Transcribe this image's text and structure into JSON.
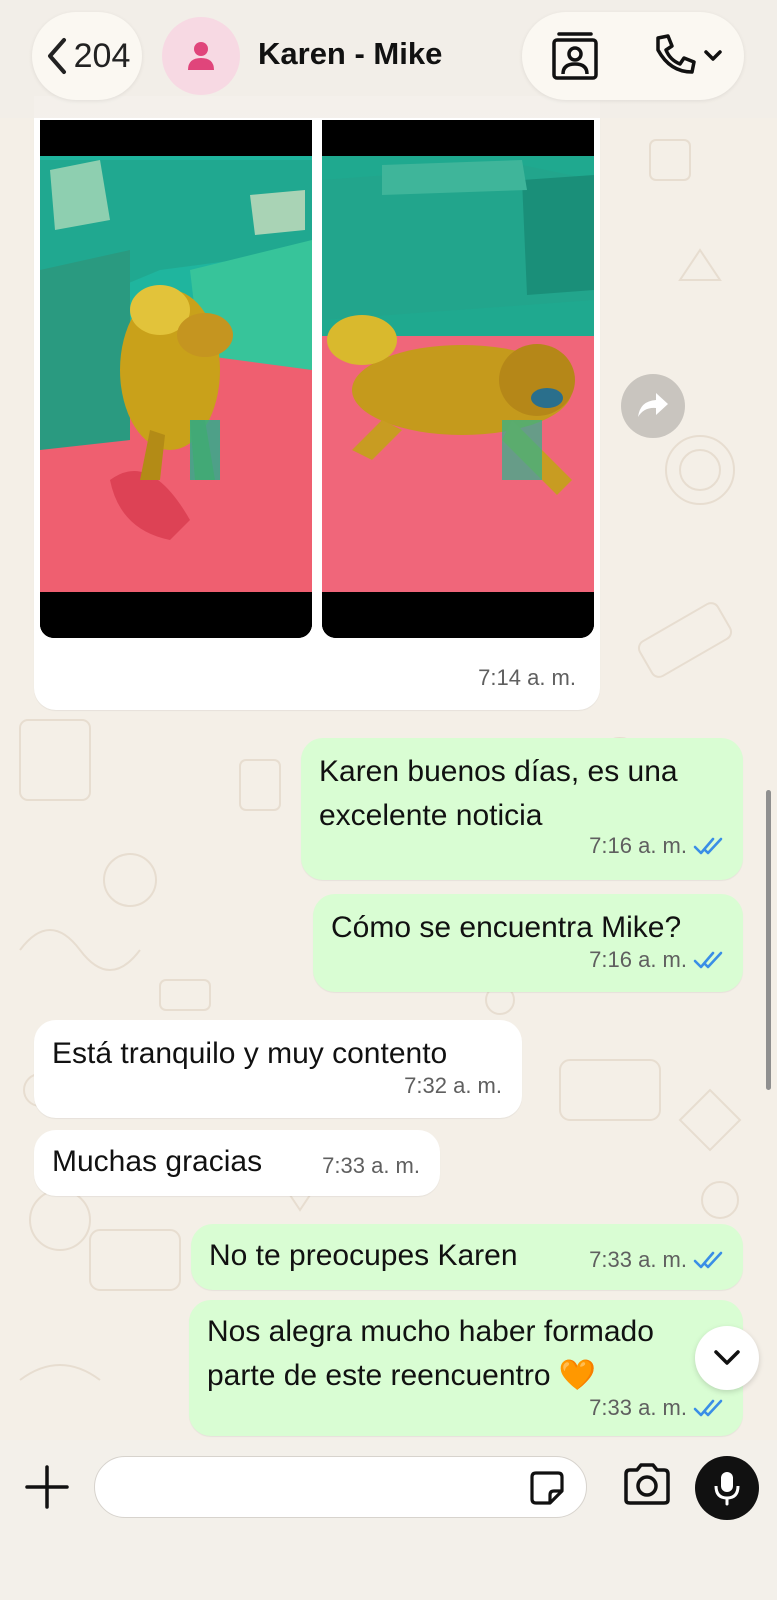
{
  "header": {
    "back_count": "204",
    "contact_name": "Karen - Mike"
  },
  "messages": [
    {
      "direction": "in",
      "type": "media",
      "time": "7:14 a. m."
    },
    {
      "direction": "out",
      "lines": [
        "Karen buenos días, es una",
        "excelente noticia"
      ],
      "time": "7:16 a. m.",
      "read": true
    },
    {
      "direction": "out",
      "text": "Cómo se encuentra Mike?",
      "time": "7:16 a. m.",
      "read": true
    },
    {
      "direction": "in",
      "text": "Está tranquilo y muy contento",
      "time": "7:32 a. m."
    },
    {
      "direction": "in",
      "text": "Muchas gracias",
      "time": "7:33 a. m."
    },
    {
      "direction": "out",
      "text": "No te preocupes Karen",
      "time": "7:33 a. m.",
      "read": true
    },
    {
      "direction": "out",
      "lines": [
        "Nos alegra mucho haber formado",
        "parte de este reencuentro 🧡"
      ],
      "time": "7:33 a. m.",
      "read": true
    }
  ],
  "composer": {
    "value": ""
  },
  "icons": {
    "back": "chevron-left-icon",
    "avatar": "person-icon",
    "video": "video-call-icon",
    "phone": "phone-icon",
    "forward": "forward-icon",
    "scroll_down": "chevron-down-icon",
    "attach": "plus-icon",
    "sticker": "sticker-icon",
    "camera": "camera-icon",
    "mic": "microphone-icon"
  },
  "colors": {
    "incoming_bubble": "#ffffff",
    "outgoing_bubble": "#d9fdd3",
    "read_ticks": "#3a8ee6",
    "avatar_bg": "#f7d9e3",
    "avatar_fg": "#e0457b",
    "chat_bg": "#f4efe7"
  }
}
